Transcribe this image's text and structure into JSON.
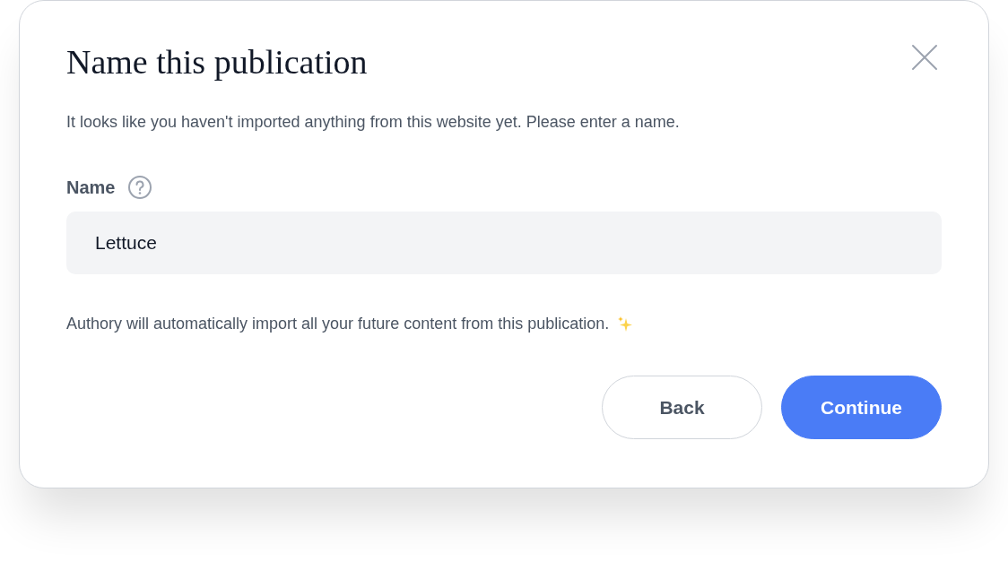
{
  "dialog": {
    "title": "Name this publication",
    "description": "It looks like you haven't imported anything from this website yet. Please enter a name.",
    "field": {
      "label": "Name",
      "value": "Lettuce"
    },
    "note": "Authory will automatically import all your future content from this publication.",
    "buttons": [
      {
        "label": "Back",
        "kind": "secondary"
      },
      {
        "label": "Continue",
        "kind": "primary"
      }
    ]
  }
}
